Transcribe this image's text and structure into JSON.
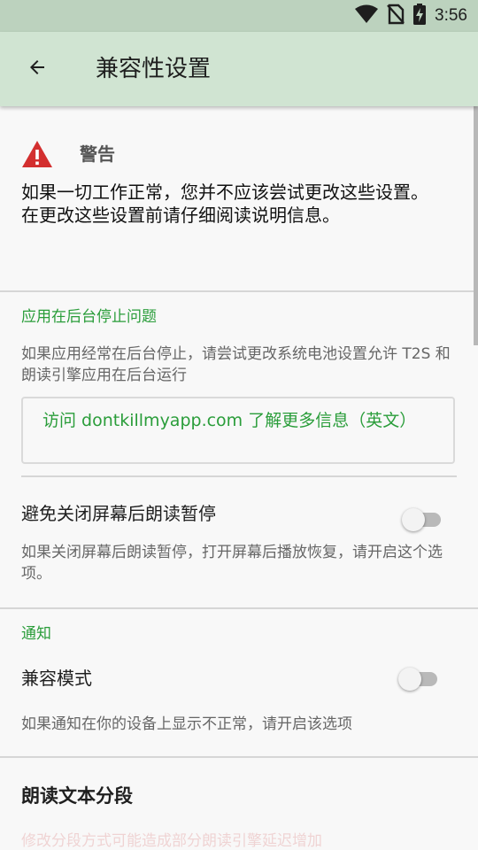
{
  "status_bar": {
    "time": "3:56",
    "icons": [
      "wifi-icon",
      "no-sim-icon",
      "battery-charging-icon"
    ]
  },
  "app_bar": {
    "back_icon": "arrow-back-icon",
    "title": "兼容性设置"
  },
  "warning": {
    "icon": "warning-triangle-icon",
    "accent_color": "#d32f2f",
    "title": "警告",
    "line1": "如果一切工作正常，您并不应该尝试更改这些设置。",
    "line2": "在更改这些设置前请仔细阅读说明信息。"
  },
  "background_section": {
    "title": "应用在后台停止问题",
    "description": "如果应用经常在后台停止，请尝试更改系统电池设置允许 T2S 和朗读引擎应用在后台运行",
    "link_text": "访问 dontkillmyapp.com 了解更多信息（英文）"
  },
  "screen_off_pref": {
    "title": "避免关闭屏幕后朗读暂停",
    "description": "如果关闭屏幕后朗读暂停，打开屏幕后播放恢复，请开启这个选项。",
    "enabled": false
  },
  "notification_section": {
    "title": "通知",
    "compat_mode_title": "兼容模式",
    "compat_mode_enabled": false,
    "description": "如果通知在你的设备上显示不正常，请开启该选项"
  },
  "segment_section": {
    "title": "朗读文本分段",
    "faded_text": "修改分段方式可能造成部分朗读引擎延迟增加"
  },
  "colors": {
    "accent_green": "#2a9d3a",
    "app_bar": "#d0e4d2",
    "status_bar": "#bcd2be"
  }
}
